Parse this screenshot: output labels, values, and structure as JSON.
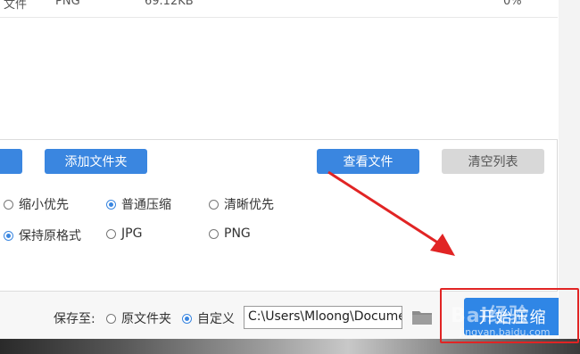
{
  "file_list": {
    "row": {
      "name": "文件",
      "type": "PNG",
      "size": "69.12KB",
      "progress": "0%"
    }
  },
  "buttons": {
    "add_file": "",
    "add_folder": "添加文件夹",
    "view_files": "查看文件",
    "clear_list": "清空列表"
  },
  "compress_mode": {
    "options": [
      "缩小优先",
      "普通压缩",
      "清晰优先"
    ],
    "selected": "普通压缩"
  },
  "output_format": {
    "options": [
      "保持原格式",
      "JPG",
      "PNG"
    ],
    "selected": "保持原格式"
  },
  "footer": {
    "save_to_label": "保存至:",
    "original_folder": "原文件夹",
    "custom": "自定义",
    "path_value": "C:\\Users\\Mloong\\Documents",
    "start_button": "开始压缩"
  },
  "watermark": {
    "main": "Bai经验",
    "sub": "jingyan.baidu.com"
  },
  "colors": {
    "accent": "#3a86e0",
    "highlight": "#e12424"
  }
}
